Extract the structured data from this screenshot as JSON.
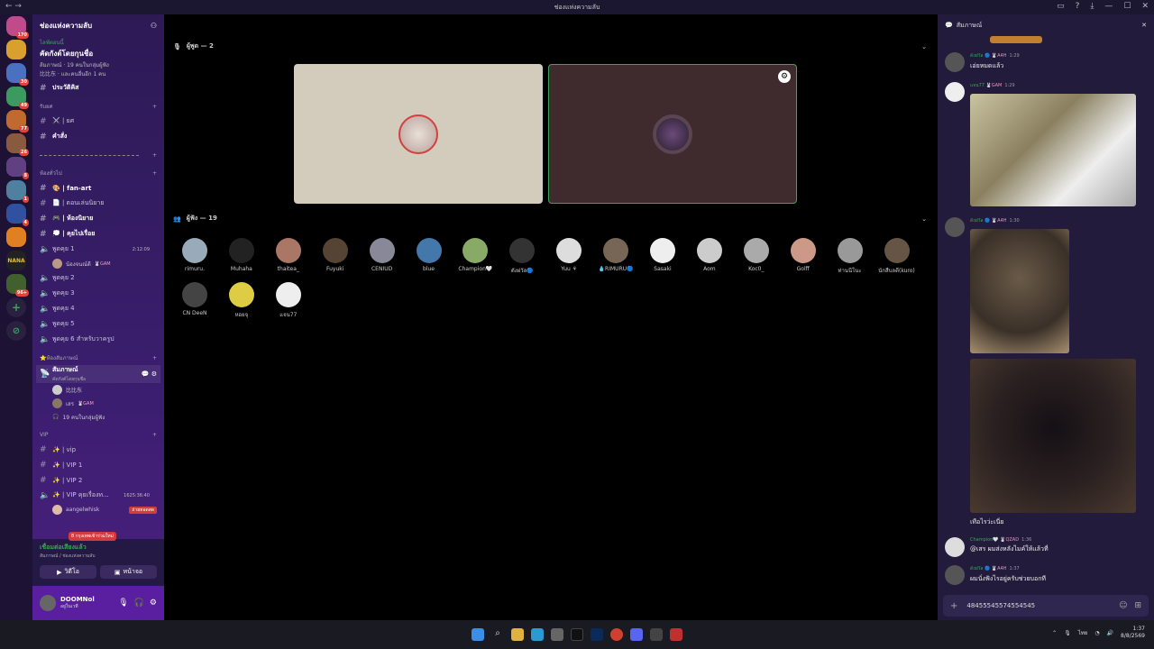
{
  "window": {
    "title": "ช่องแห่งความลับ"
  },
  "server_list": [
    {
      "badge": "170"
    },
    {
      "badge": ""
    },
    {
      "badge": "30"
    },
    {
      "badge": "49"
    },
    {
      "badge": "77"
    },
    {
      "badge": "26"
    },
    {
      "badge": "8"
    },
    {
      "badge": "1"
    },
    {
      "badge": "4"
    },
    {
      "badge": ""
    },
    {
      "badge": ""
    },
    {
      "badge": "96+"
    }
  ],
  "sidebar": {
    "server_name": "ช่องแห่งความลับ",
    "event": {
      "live": "ไลฟ์ตอนนี้",
      "title": "คัดกังต์โดยกุนชื่อ",
      "line1": "ส้มภาษณ์ · 19 คนในกลุ่มผู้ฟัง",
      "line2": "比比东 · และคนอื่นอีก 1 คน"
    },
    "ch_pr": "ประวัติคิส",
    "cat_rules": "รับยศ",
    "ch_role": "⚔️ | ยศ",
    "ch_cmd": "คำสั่ง",
    "divider": "",
    "cat_general": "ห้องทั่วไป",
    "ch_fanart": "🎨 | fan-art",
    "ch_novel": "📄 | ตอนเล่นนิยาย",
    "ch_novelchat": "🎮 | ห้องนิยาย",
    "ch_story": "💭 | คุยไปเรื่อย",
    "vc_talk1": "พูดคุย 1",
    "vc_talk1_time": "2:12:09",
    "vc_talk1_user": "น้องจนณ์ดี",
    "vc_talk1_tag": "🐰GAM",
    "vc_talk2": "พูดคุย 2",
    "vc_talk3": "พูดคุย 3",
    "vc_talk4": "พูดคุย 4",
    "vc_talk5": "พูดคุย 5",
    "vc_talk6": "พูดคุย 6 สำหรับวาครูป",
    "cat_interview": "⭐ห้องสัมภาษณ์",
    "stage_name": "สัมภาษณ์",
    "stage_sub": "คัดกังต์โดยกุนชื่อ",
    "stage_user1": "比比东",
    "stage_user2": "เสร",
    "stage_user2_tag": "🐰GAM",
    "stage_listeners": "19 คนในกลุ่มผู้ฟัง",
    "cat_vip": "VIP",
    "ch_vip": "✨ | vip",
    "ch_vip1": "✨ | VIP 1",
    "ch_vip2": "✨ | VIP 2",
    "vc_vip": "✨ | VIP คุยเรื่องท...",
    "vc_vip_time": "1625:36:40",
    "vc_vip_user1": "aangelwhisk",
    "vc_vip_user2": "8 กรุงเทพเข้าร่วมใหม่",
    "vc_vip_badge": "ถ่ายทอดสด",
    "voice": {
      "status": "เชื่อมต่อเสียงแล้ว",
      "sub": "สัมภาษณ์ / ช่องแห่งความลับ",
      "video": "วิดีโอ",
      "screen": "หน้าจอ"
    },
    "user": {
      "name": "DOOMNol",
      "status": "อยู่ในเวที"
    }
  },
  "stage": {
    "speakers_label": "ผู้พูด — 2",
    "audience_label": "ผู้ฟัง — 19",
    "audience": [
      "rimuru.",
      "Muhaha",
      "thaitea_",
      "Fuyuki",
      "CENIUD",
      "blue",
      "Champion🤍",
      "ดังฝวัล🔵",
      "Yuu ⚘",
      "💧RIMURU🔵",
      "Sasaki",
      "Aom",
      "Koc0_",
      "Golff",
      "ท่านนีโนะ",
      "นักสืบลดี(kuro)",
      "CN DeeN",
      "หอยจุ",
      "แจน77"
    ],
    "audience_colors": [
      "#9ab",
      "#222",
      "#a76",
      "#543",
      "#889",
      "#47a",
      "#8a6",
      "#333",
      "#ddd",
      "#765",
      "#eee",
      "#ccc",
      "#aaa",
      "#c98",
      "#999",
      "#654",
      "#444",
      "#dc4",
      "#eee"
    ]
  },
  "chat": {
    "title": "สัมภาษณ์",
    "messages": [
      {
        "user": "ดังฝวัล 🔵",
        "tag": "🐰A4H",
        "time": "1:29",
        "text": "เอ่ยหมดแล้ว"
      },
      {
        "user": "แจน77",
        "tag": "🐰GAM",
        "time": "1:29",
        "text": ""
      },
      {
        "user": "ดังฝวัล 🔵",
        "tag": "🐰A4H",
        "time": "1:30",
        "text": "เทือไรว่ะเนี่ย"
      },
      {
        "user": "Champion🤍",
        "tag": "🐰QZAD",
        "time": "1:36",
        "text": "@เสร ผมส่งหลังไมค์ให้แล้วที่"
      },
      {
        "user": "ดังฝวัล 🔵",
        "tag": "🐰A4H",
        "time": "1:37",
        "text": "ผมนั่งฟังไรอยู่ครับช่วยบอกที"
      }
    ],
    "input_value": "48455545574554545"
  },
  "taskbar": {
    "lang": "ไทย",
    "time": "1:37",
    "date": "8/8/2569"
  }
}
